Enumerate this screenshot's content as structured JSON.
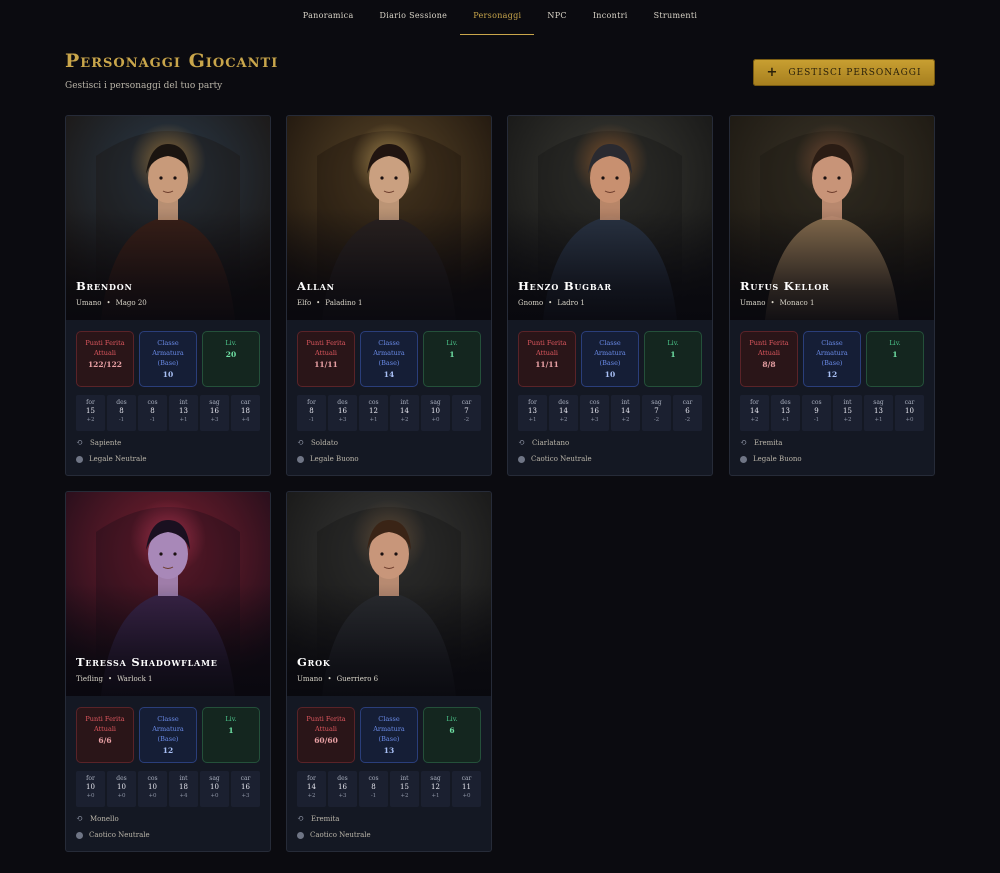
{
  "nav": {
    "items": [
      {
        "label": "Panoramica",
        "active": false
      },
      {
        "label": "Diario Sessione",
        "active": false
      },
      {
        "label": "Personaggi",
        "active": true
      },
      {
        "label": "NPC",
        "active": false
      },
      {
        "label": "Incontri",
        "active": false
      },
      {
        "label": "Strumenti",
        "active": false
      }
    ]
  },
  "header": {
    "title": "Personaggi Giocanti",
    "subtitle": "Gestisci i personaggi del tuo party",
    "manage_button": "GESTISCI PERSONAGGI",
    "manage_icon": "plus-icon"
  },
  "labels": {
    "hp": "Punti Ferita\nAttuali",
    "ac": "Classe\nArmatura\n(Base)",
    "lv": "Liv.",
    "abilities": [
      "for",
      "des",
      "cos",
      "int",
      "sag",
      "car"
    ]
  },
  "colors": {
    "accent": "#c9a64b",
    "hp": "#e0585f",
    "ac": "#6a8be8",
    "lv": "#4cc48a"
  },
  "characters": [
    {
      "name": "Brendon",
      "race": "Umano",
      "class": "Mago 20",
      "hp": "122/122",
      "ac": "10",
      "level": "20",
      "abilities": [
        [
          "15",
          "+2"
        ],
        [
          "8",
          "-1"
        ],
        [
          "8",
          "-1"
        ],
        [
          "13",
          "+1"
        ],
        [
          "16",
          "+3"
        ],
        [
          "18",
          "+4"
        ]
      ],
      "background": "Sapiente",
      "alignment": "Legale Neutrale"
    },
    {
      "name": "Allan",
      "race": "Elfo",
      "class": "Paladino 1",
      "hp": "11/11",
      "ac": "14",
      "level": "1",
      "abilities": [
        [
          "8",
          "-1"
        ],
        [
          "16",
          "+3"
        ],
        [
          "12",
          "+1"
        ],
        [
          "14",
          "+2"
        ],
        [
          "10",
          "+0"
        ],
        [
          "7",
          "-2"
        ]
      ],
      "background": "Soldato",
      "alignment": "Legale Buono"
    },
    {
      "name": "Henzo Bugbar",
      "race": "Gnomo",
      "class": "Ladro 1",
      "hp": "11/11",
      "ac": "10",
      "level": "1",
      "abilities": [
        [
          "13",
          "+1"
        ],
        [
          "14",
          "+2"
        ],
        [
          "16",
          "+3"
        ],
        [
          "14",
          "+2"
        ],
        [
          "7",
          "-2"
        ],
        [
          "6",
          "-2"
        ]
      ],
      "background": "Ciarlatano",
      "alignment": "Caotico Neutrale"
    },
    {
      "name": "Rufus Kellor",
      "race": "Umano",
      "class": "Monaco 1",
      "hp": "8/8",
      "ac": "12",
      "level": "1",
      "abilities": [
        [
          "14",
          "+2"
        ],
        [
          "13",
          "+1"
        ],
        [
          "9",
          "-1"
        ],
        [
          "15",
          "+2"
        ],
        [
          "13",
          "+1"
        ],
        [
          "10",
          "+0"
        ]
      ],
      "background": "Eremita",
      "alignment": "Legale Buono"
    },
    {
      "name": "Teressa Shadowflame",
      "race": "Tiefling",
      "class": "Warlock 1",
      "hp": "6/6",
      "ac": "12",
      "level": "1",
      "abilities": [
        [
          "10",
          "+0"
        ],
        [
          "10",
          "+0"
        ],
        [
          "10",
          "+0"
        ],
        [
          "18",
          "+4"
        ],
        [
          "10",
          "+0"
        ],
        [
          "16",
          "+3"
        ]
      ],
      "background": "Monello",
      "alignment": "Caotico Neutrale"
    },
    {
      "name": "Grok",
      "race": "Umano",
      "class": "Guerriero 6",
      "hp": "60/60",
      "ac": "13",
      "level": "6",
      "abilities": [
        [
          "14",
          "+2"
        ],
        [
          "16",
          "+3"
        ],
        [
          "8",
          "-1"
        ],
        [
          "15",
          "+2"
        ],
        [
          "12",
          "+1"
        ],
        [
          "11",
          "+0"
        ]
      ],
      "background": "Eremita",
      "alignment": "Caotico Neutrale"
    }
  ]
}
